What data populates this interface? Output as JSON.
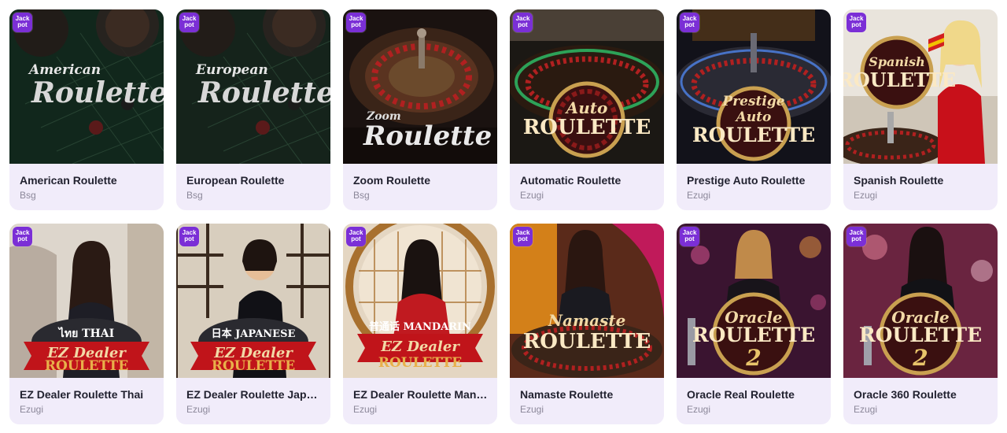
{
  "badge_label": [
    "Jack",
    "pot"
  ],
  "colors": {
    "badge": "#7b2fd6",
    "card_bg": "#f1ecfa",
    "title": "#222230",
    "provider": "#8b8799"
  },
  "games": [
    {
      "name": "American Roulette",
      "provider": "Bsg",
      "art_title": [
        "American",
        "Roulette"
      ]
    },
    {
      "name": "European Roulette",
      "provider": "Bsg",
      "art_title": [
        "European",
        "Roulette"
      ]
    },
    {
      "name": "Zoom Roulette",
      "provider": "Bsg",
      "art_title": [
        "Zoom",
        "Roulette"
      ]
    },
    {
      "name": "Automatic Roulette",
      "provider": "Ezugi",
      "art_title": [
        "Auto",
        "ROULETTE"
      ]
    },
    {
      "name": "Prestige Auto Roulette",
      "provider": "Ezugi",
      "art_title": [
        "Prestige",
        "Auto",
        "ROULETTE"
      ]
    },
    {
      "name": "Spanish Roulette",
      "provider": "Ezugi",
      "art_title": [
        "Spanish",
        "ROULETTE"
      ]
    },
    {
      "name": "EZ Dealer Roulette Thai",
      "provider": "Ezugi",
      "art_title": [
        "ไทย THAI",
        "EZ Dealer",
        "ROULETTE"
      ]
    },
    {
      "name": "EZ Dealer Roulette Japanese",
      "provider": "Ezugi",
      "art_title": [
        "日本 JAPANESE",
        "EZ Dealer",
        "ROULETTE"
      ]
    },
    {
      "name": "EZ Dealer Roulette Mandarin",
      "provider": "Ezugi",
      "art_title": [
        "普通话 MANDARIN",
        "EZ Dealer",
        "ROULETTE"
      ]
    },
    {
      "name": "Namaste Roulette",
      "provider": "Ezugi",
      "art_title": [
        "Namaste",
        "ROULETTE"
      ]
    },
    {
      "name": "Oracle Real Roulette",
      "provider": "Ezugi",
      "art_title": [
        "Oracle",
        "ROULETTE",
        "2"
      ]
    },
    {
      "name": "Oracle 360 Roulette",
      "provider": "Ezugi",
      "art_title": [
        "Oracle",
        "ROULETTE",
        "2"
      ]
    }
  ]
}
